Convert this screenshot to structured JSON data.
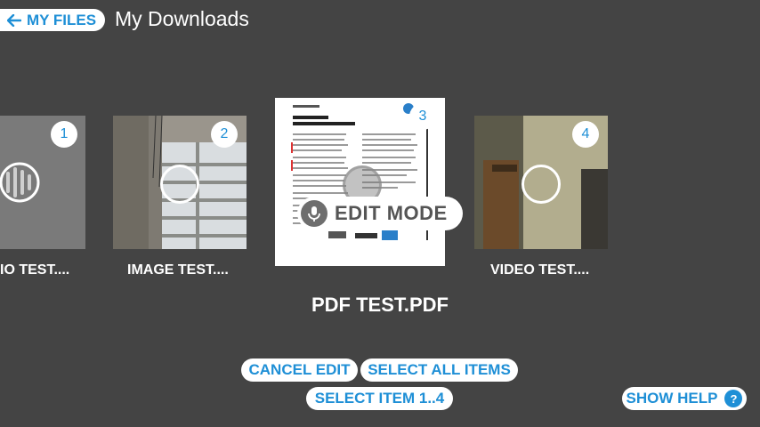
{
  "header": {
    "back_label": "MY FILES",
    "title": "My Downloads"
  },
  "items": [
    {
      "number": "1",
      "caption": "IO TEST....",
      "type": "audio"
    },
    {
      "number": "2",
      "caption": "IMAGE TEST....",
      "type": "image"
    },
    {
      "number": "3",
      "caption": "",
      "type": "pdf"
    },
    {
      "number": "4",
      "caption": "VIDEO TEST....",
      "type": "video"
    }
  ],
  "overlay": {
    "edit_mode_label": "EDIT MODE"
  },
  "selected_name": "PDF TEST.PDF",
  "actions": {
    "cancel_edit": "CANCEL EDIT",
    "select_all": "SELECT ALL ITEMS",
    "select_item": "SELECT ITEM 1..4",
    "show_help": "SHOW HELP",
    "help_glyph": "?"
  },
  "colors": {
    "background": "#444444",
    "accent": "#1e8fd6"
  }
}
